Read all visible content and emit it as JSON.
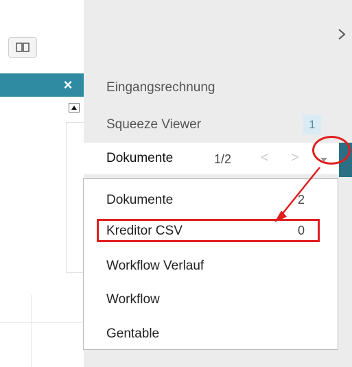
{
  "panel": {
    "menu": [
      {
        "label": "Eingangsrechnung"
      },
      {
        "label": "Squeeze Viewer",
        "badge": "1"
      }
    ],
    "tab": {
      "label": "Dokumente",
      "page": "1/2",
      "prev": "<",
      "next": ">"
    }
  },
  "dropdown": {
    "items": [
      {
        "label": "Dokumente",
        "count": "2"
      },
      {
        "label": "Kreditor CSV",
        "count": "0"
      },
      {
        "label": "Workflow Verlauf",
        "count": ""
      },
      {
        "label": "Workflow",
        "count": ""
      },
      {
        "label": "Gentable",
        "count": ""
      }
    ]
  },
  "header": {
    "close_glyph": "×"
  },
  "colors": {
    "teal": "#2e8ba1",
    "highlight": "#e01e1e",
    "badge_bg": "#d9ecf5"
  },
  "icons": [
    "book-icon",
    "close-icon",
    "chevron-right-icon",
    "chevron-down-icon",
    "scroll-up-icon"
  ]
}
